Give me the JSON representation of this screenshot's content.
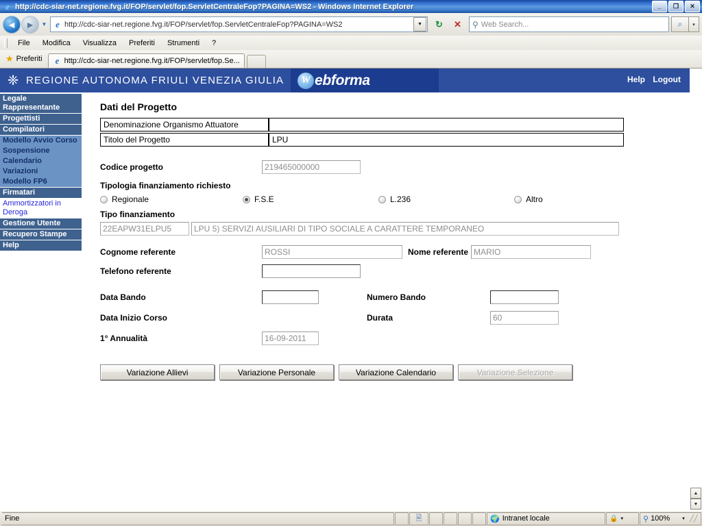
{
  "browser": {
    "window_title": "http://cdc-siar-net.regione.fvg.it/FOP/servlet/fop.ServletCentraleFop?PAGINA=WS2 - Windows Internet Explorer",
    "minimize_label": "_",
    "maximize_label": "❐",
    "close_label": "✕",
    "address_value": "http://cdc-siar-net.regione.fvg.it/FOP/servlet/fop.ServletCentraleFop?PAGINA=WS2",
    "refresh_label": "↻",
    "stop_label": "✕",
    "search_placeholder": "Web Search...",
    "search_go_label": "⌕",
    "search_drop_label": "▾",
    "back_label": "◄",
    "forward_label": "►",
    "history_drop_label": "▼",
    "address_drop_label": "▼",
    "menu_items": [
      "File",
      "Modifica",
      "Visualizza",
      "Preferiti",
      "Strumenti",
      "?"
    ],
    "favorites_label": "Preferiti",
    "tab_title": "http://cdc-siar-net.regione.fvg.it/FOP/servlet/fop.Se...",
    "ie_glyph": "e"
  },
  "status": {
    "message": "Fine",
    "zone": "Intranet locale",
    "zoom": "100%",
    "protected_drop": "▾",
    "zoom_drop": "▾"
  },
  "banner": {
    "region": "REGIONE AUTONOMA FRIULI VENEZIA GIULIA",
    "logo_initial": "W",
    "logo_text": "ebforma",
    "help": "Help",
    "logout": "Logout",
    "crest_glyph": "❈"
  },
  "sidebar": {
    "items": [
      {
        "label": "Legale Rappresentante",
        "style": "item"
      },
      {
        "label": "Progettisti",
        "style": "item"
      },
      {
        "label": "Compilatori",
        "style": "item"
      },
      {
        "label": "Modello Avvio Corso",
        "style": "group"
      },
      {
        "label": "Sospensione",
        "style": "group"
      },
      {
        "label": "Calendario",
        "style": "group"
      },
      {
        "label": "Variazioni",
        "style": "group"
      },
      {
        "label": "Modello FP6",
        "style": "group"
      },
      {
        "label": "Firmatari",
        "style": "item"
      },
      {
        "label": "Ammortizzatori in Deroga",
        "style": "link"
      },
      {
        "label": "Gestione Utente",
        "style": "item"
      },
      {
        "label": "Recupero Stampe",
        "style": "item"
      },
      {
        "label": "Help",
        "style": "item"
      }
    ]
  },
  "form": {
    "title": "Dati del Progetto",
    "denominazione_label": "Denominazione Organismo Attuatore",
    "denominazione_value": "",
    "titolo_label": "Titolo del Progetto",
    "titolo_value": "LPU",
    "codice_label": "Codice progetto",
    "codice_value": "219465000000",
    "tipologia_label": "Tipologia finanziamento richiesto",
    "radios": [
      {
        "label": "Regionale",
        "checked": false
      },
      {
        "label": "F.S.E",
        "checked": true
      },
      {
        "label": "L.236",
        "checked": false
      },
      {
        "label": "Altro",
        "checked": false
      }
    ],
    "tipo_fin_label": "Tipo finanziamento",
    "tipo_fin_code": "22EAPW31ELPU5",
    "tipo_fin_desc": "LPU 5) SERVIZI AUSILIARI DI TIPO SOCIALE A CARATTERE TEMPORANEO",
    "cognome_label": "Cognome referente",
    "cognome_value": "ROSSI",
    "nome_label": "Nome referente",
    "nome_value": "MARIO",
    "telefono_label": "Telefono referente",
    "telefono_value": "",
    "data_bando_label": "Data Bando",
    "data_bando_value": "",
    "numero_bando_label": "Numero Bando",
    "numero_bando_value": "",
    "data_inizio_label": "Data Inizio Corso",
    "durata_label": "Durata",
    "durata_value": "60",
    "annualita_label": "1° Annualità",
    "annualita_value": "16-09-2011",
    "buttons": [
      {
        "label": "Variazione Allievi",
        "disabled": false
      },
      {
        "label": "Variazione Personale",
        "disabled": false
      },
      {
        "label": "Variazione Calendario",
        "disabled": false
      },
      {
        "label": "Variazione Selezione",
        "disabled": true
      }
    ]
  },
  "scroll": {
    "up_label": "▲",
    "down_label": "▼"
  }
}
